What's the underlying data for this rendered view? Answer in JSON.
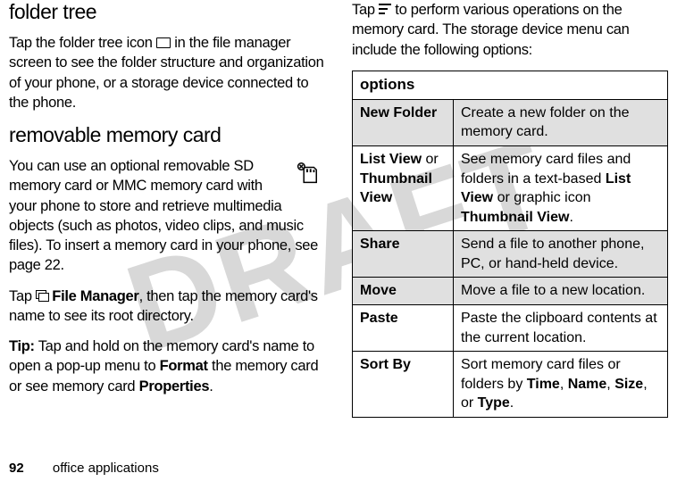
{
  "watermark": "DRAFT",
  "left": {
    "heading1": "folder tree",
    "para1a": "Tap the folder tree icon ",
    "para1b": " in the file manager screen to see the folder structure and organization of your phone, or a storage device connected to the phone.",
    "heading2": "removable memory card",
    "para2": "You can use an optional removable SD memory card or  MMC memory card with your phone to store and retrieve multimedia objects (such as photos, video clips, and music files). To insert a memory card in your phone, see page 22.",
    "para3a": "Tap ",
    "para3b": "File Manager",
    "para3c": ", then tap the memory card's name to see its root directory.",
    "tip_label": "Tip:",
    "tip_a": " Tap and hold on the memory card's name to open a pop-up menu to ",
    "tip_fmt": "Format",
    "tip_b": " the memory card or see memory card ",
    "tip_prop": "Properties",
    "tip_c": "."
  },
  "right": {
    "intro_a": "Tap ",
    "intro_b": " to perform various operations on the memory card. The storage device menu can include the following options:",
    "table_header": "options",
    "rows": [
      {
        "label": "New Folder",
        "desc_a": "Create a new folder on the memory card."
      },
      {
        "label_a": "List View",
        "label_or": " or ",
        "label_b": "Thumbnail View",
        "desc_a": "See memory card files and folders in a text-based ",
        "desc_bold1": "List View",
        "desc_b": " or graphic icon ",
        "desc_bold2": "Thumbnail View",
        "desc_c": "."
      },
      {
        "label": "Share",
        "desc_a": "Send a file to another phone, PC, or hand-held device."
      },
      {
        "label": "Move",
        "desc_a": "Move a file to a new location."
      },
      {
        "label": "Paste",
        "desc_a": "Paste the clipboard contents at the current location."
      },
      {
        "label": "Sort By",
        "desc_a": "Sort memory card files or folders by ",
        "b1": "Time",
        "s1": ", ",
        "b2": "Name",
        "s2": ", ",
        "b3": "Size",
        "s3": ", or ",
        "b4": "Type",
        "s4": "."
      }
    ]
  },
  "footer": {
    "page": "92",
    "section": "office applications"
  }
}
